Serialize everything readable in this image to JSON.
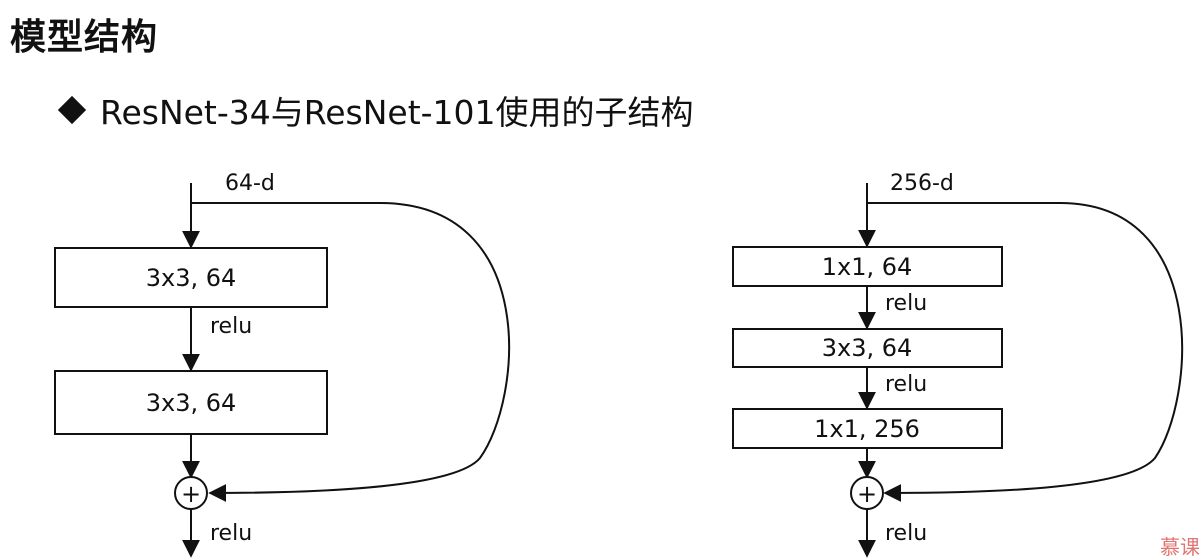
{
  "page": {
    "title": "模型结构",
    "subtitle": "ResNet-34与ResNet-101使用的子结构"
  },
  "basic_block": {
    "input_label": "64-d",
    "layers": [
      "3x3, 64",
      "3x3, 64"
    ],
    "relu_labels": [
      "relu",
      "relu"
    ],
    "add_symbol": "+"
  },
  "bottleneck_block": {
    "input_label": "256-d",
    "layers": [
      "1x1, 64",
      "3x3, 64",
      "1x1, 256"
    ],
    "relu_labels": [
      "relu",
      "relu",
      "relu"
    ],
    "add_symbol": "+"
  },
  "watermark": {
    "text": "慕课"
  }
}
